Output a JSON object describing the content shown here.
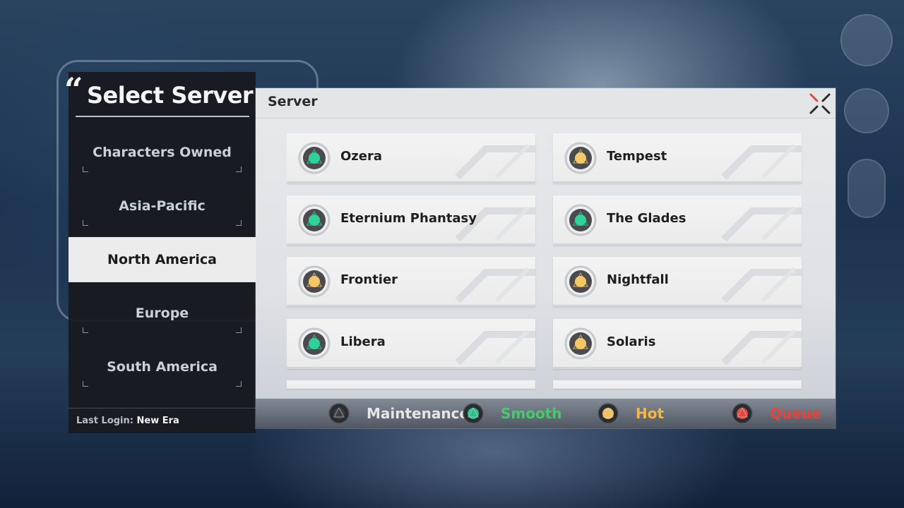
{
  "title": "Select Server",
  "regions": [
    {
      "label": "Characters Owned",
      "selected": false
    },
    {
      "label": "Asia-Pacific",
      "selected": false
    },
    {
      "label": "North America",
      "selected": true
    },
    {
      "label": "Europe",
      "selected": false
    },
    {
      "label": "South America",
      "selected": false
    }
  ],
  "last_login": {
    "label": "Last Login:",
    "value": "New Era"
  },
  "main": {
    "title": "Server"
  },
  "servers": [
    {
      "name": "Ozera",
      "status": "smooth"
    },
    {
      "name": "Tempest",
      "status": "hot"
    },
    {
      "name": "Eternium Phantasy",
      "status": "smooth"
    },
    {
      "name": "The Glades",
      "status": "smooth"
    },
    {
      "name": "Frontier",
      "status": "hot"
    },
    {
      "name": "Nightfall",
      "status": "hot"
    },
    {
      "name": "Libera",
      "status": "smooth"
    },
    {
      "name": "Solaris",
      "status": "hot"
    }
  ],
  "legend": [
    {
      "key": "maintenance",
      "label": "Maintenance",
      "color": "#e6e6e6",
      "dot": "#3a3d42"
    },
    {
      "key": "smooth",
      "label": "Smooth",
      "color": "#49c96d",
      "dot": "#2fbf8f"
    },
    {
      "key": "hot",
      "label": "Hot",
      "color": "#f0b74a",
      "dot": "#f2c061"
    },
    {
      "key": "queue",
      "label": "Queue",
      "color": "#e0473c",
      "dot": "#e0473c"
    }
  ],
  "status_colors": {
    "smooth": "#2fd39a",
    "hot": "#f5c867"
  },
  "icons": {
    "close": "close-x-icon",
    "status": "status-orb-icon"
  }
}
